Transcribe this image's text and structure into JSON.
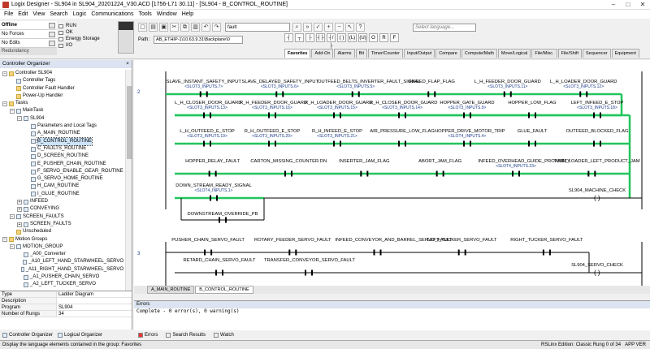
{
  "window": {
    "title": "Logix Designer - SL904 in SL904_20201224_V30.ACD [1756-L71 30.11] - [SL904 - B_CONTROL_ROUTINE]",
    "minimize": "–",
    "maximize": "□",
    "close": "✕"
  },
  "menu": [
    "File",
    "Edit",
    "View",
    "Search",
    "Logic",
    "Communications",
    "Tools",
    "Window",
    "Help"
  ],
  "controller_status": {
    "mode": "Offline",
    "forces": "No Forces",
    "edits": "No Edits",
    "redundancy": "Redundancy",
    "leds": [
      "RUN",
      "OK",
      "Energy Storage",
      "I/O"
    ]
  },
  "toolbar": {
    "search_value": "fault",
    "language_search_placeholder": "Select language...",
    "path_label": "Path:",
    "path_value": "AB_ETHIP-1\\10.63.9.31\\Backplane\\0"
  },
  "instruction_tabs": [
    "Favorites",
    "Add-On",
    "Alarms",
    "Bit",
    "Timer/Counter",
    "Input/Output",
    "Compare",
    "Compute/Math",
    "Move/Logical",
    "File/Misc.",
    "File/Shift",
    "Sequencer",
    "Equipment"
  ],
  "organizer": {
    "title": "Controller Organizer",
    "close": "×",
    "tree": [
      {
        "label": "Controller SL904",
        "level": 0,
        "exp": "−",
        "type": "folder"
      },
      {
        "label": "Controller Tags",
        "level": 1,
        "exp": "",
        "type": "item"
      },
      {
        "label": "Controller Fault Handler",
        "level": 1,
        "exp": "",
        "type": "folder"
      },
      {
        "label": "Power-Up Handler",
        "level": 1,
        "exp": "",
        "type": "folder"
      },
      {
        "label": "Tasks",
        "level": 0,
        "exp": "−",
        "type": "folder"
      },
      {
        "label": "MainTask",
        "level": 1,
        "exp": "−",
        "type": "item"
      },
      {
        "label": "SL904",
        "level": 2,
        "exp": "−",
        "type": "item"
      },
      {
        "label": "Parameters and Local Tags",
        "level": 3,
        "exp": "",
        "type": "item"
      },
      {
        "label": "A_MAIN_ROUTINE",
        "level": 3,
        "exp": "",
        "type": "item"
      },
      {
        "label": "B_CONTROL_ROUTINE",
        "level": 3,
        "exp": "",
        "type": "item",
        "selected": true
      },
      {
        "label": "C_FAULTS_ROUTINE",
        "level": 3,
        "exp": "",
        "type": "item"
      },
      {
        "label": "D_SCREEN_ROUTINE",
        "level": 3,
        "exp": "",
        "type": "item"
      },
      {
        "label": "E_PUSHER_CHAIN_ROUTINE",
        "level": 3,
        "exp": "",
        "type": "item"
      },
      {
        "label": "F_SERVO_ENABLE_GEAR_ROUTINE",
        "level": 3,
        "exp": "",
        "type": "item"
      },
      {
        "label": "G_SERVO_HOME_ROUTINE",
        "level": 3,
        "exp": "",
        "type": "item"
      },
      {
        "label": "H_CAM_ROUTINE",
        "level": 3,
        "exp": "",
        "type": "item"
      },
      {
        "label": "I_GLUE_ROUTINE",
        "level": 3,
        "exp": "",
        "type": "item"
      },
      {
        "label": "INFEED",
        "level": 2,
        "exp": "+",
        "type": "item"
      },
      {
        "label": "CONVEYING",
        "level": 2,
        "exp": "+",
        "type": "item"
      },
      {
        "label": "SCREEN_FAULTS",
        "level": 1,
        "exp": "−",
        "type": "item"
      },
      {
        "label": "SCREEN_FAULTS",
        "level": 2,
        "exp": "+",
        "type": "item"
      },
      {
        "label": "Unscheduled",
        "level": 1,
        "exp": "",
        "type": "folder"
      },
      {
        "label": "Motion Groups",
        "level": 0,
        "exp": "−",
        "type": "folder"
      },
      {
        "label": "MOTION_GROUP",
        "level": 1,
        "exp": "−",
        "type": "item"
      },
      {
        "label": "_A00_Converter",
        "level": 2,
        "exp": "",
        "type": "item"
      },
      {
        "label": "_A10_LEFT_HAND_STARWHEEL_SERVO",
        "level": 2,
        "exp": "",
        "type": "item"
      },
      {
        "label": "_A11_RIGHT_HAND_STARWHEEL_SERVO",
        "level": 2,
        "exp": "",
        "type": "item"
      },
      {
        "label": "_A1_PUSHER_CHAIN_SERVO",
        "level": 2,
        "exp": "",
        "type": "item"
      },
      {
        "label": "_A2_LEFT_TUCKER_SERVO",
        "level": 2,
        "exp": "",
        "type": "item"
      }
    ]
  },
  "properties": [
    {
      "k": "Type",
      "v": "Ladder Diagram"
    },
    {
      "k": "Description",
      "v": ""
    },
    {
      "k": "Program",
      "v": "SL904"
    },
    {
      "k": "Number of Rungs",
      "v": "34"
    }
  ],
  "organizer_tabs": [
    "Controller Organizer",
    "Logical Organizer"
  ],
  "rungs": {
    "rung2": "2",
    "rung3": "3",
    "r2_l1": [
      {
        "name": "SLAVE_INSTANT_SAFETY_INPUT",
        "addr": "<SLOT3_INPUTS.7>"
      },
      {
        "name": "SLAVE_DELAYED_SAFETY_INPUT",
        "addr": "<SLOT3_INPUTS.6>"
      },
      {
        "name": "OUTFEED_BELTS_INVERTER_FAULT_SIGNAL",
        "addr": "<SLOT3_INPUTS.5>"
      },
      {
        "name": "INFEED_FLAP_FLAG",
        "addr": ""
      },
      {
        "name": "L_H_FEEDER_DOOR_GUARD",
        "addr": "<SLOT3_INPUTS.11>"
      },
      {
        "name": "L_H_LOADER_DOOR_GUARD",
        "addr": "<SLOT3_INPUTS.12>"
      }
    ],
    "r2_l2": [
      {
        "name": "L_H_CLOSER_DOOR_GUARD",
        "addr": "<SLOT3_INPUTS.13>"
      },
      {
        "name": "R_H_FEEDER_DOOR_GUARD",
        "addr": "<SLOT3_INPUTS.16>"
      },
      {
        "name": "R_H_LOADER_DOOR_GUARD",
        "addr": "<SLOT3_INPUTS.15>"
      },
      {
        "name": "R_H_CLOSER_DOOR_GUARD",
        "addr": "<SLOT3_INPUTS.14>"
      },
      {
        "name": "HOPPER_GATE_GUARD",
        "addr": "<SLOT3_INPUTS.9>"
      },
      {
        "name": "HOPPER_LOW_FLAG",
        "addr": ""
      },
      {
        "name": "LEFT_INFEED_E_STOP",
        "addr": "<SLOT3_INPUTS.18>"
      }
    ],
    "r2_l3": [
      {
        "name": "L_H_OUTFEED_E_STOP",
        "addr": "<SLOT3_INPUTS.19>"
      },
      {
        "name": "R_H_OUTFEED_E_STOP",
        "addr": "<SLOT3_INPUTS.20>"
      },
      {
        "name": "R_H_INFEED_E_STOP",
        "addr": "<SLOT3_INPUTS.21>"
      },
      {
        "name": "AIR_PRESSURE_LOW_FLAG",
        "addr": ""
      },
      {
        "name": "HOPPER_DRIVE_MOTOR_TRIP",
        "addr": "<SLOT4_INPUTS.4>"
      },
      {
        "name": "GLUE_FAULT",
        "addr": ""
      },
      {
        "name": "OUTFEED_BLOCKED_FLAG",
        "addr": ""
      }
    ],
    "r2_l4": [
      {
        "name": "HOPPER_RELAY_FAULT",
        "addr": ""
      },
      {
        "name": "CARTON_MISSING_COUNTER.DN",
        "addr": ""
      },
      {
        "name": "INSERTER_JAM_FLAG",
        "addr": ""
      },
      {
        "name": "ABORT_JAM_FLAG",
        "addr": ""
      },
      {
        "name": "INFEED_OVERHEAD_GUIDE_PROXIMITY",
        "addr": "<SLOT4_INPUTS.23>"
      },
      {
        "name": "TWIN_LOADER_LEFT_PRODUCT_JAM",
        "addr": ""
      }
    ],
    "r2_l5": [
      {
        "name": "DOWN_STREAM_READY_SIGNAL",
        "addr": "<SLOT4_INPUTS.1>"
      }
    ],
    "r2_branch": {
      "name": "DOWNSTREAM_OVERRIDE_PB",
      "addr": ""
    },
    "r2_coil": "SL904_MACHINE_CHECK",
    "r3_l1": [
      {
        "name": "PUSHER_CHAIN_SERVO_FAULT",
        "addr": ""
      },
      {
        "name": "ROTARY_FEEDER_SERVO_FAULT",
        "addr": ""
      },
      {
        "name": "INFEED_CONVEYOR_AND_BARREL_SERVO_FAULT",
        "addr": ""
      },
      {
        "name": "LEFT_TUCKER_SERVO_FAULT",
        "addr": ""
      },
      {
        "name": "RIGHT_TUCKER_SERVO_FAULT",
        "addr": ""
      }
    ],
    "r3_l2": [
      {
        "name": "RETARD_CHAIN_SERVO_FAULT",
        "addr": ""
      },
      {
        "name": "TRANSFER_CONVEYOR_SERVO_FAULT",
        "addr": ""
      }
    ],
    "r3_coil": "SL904_SERVO_CHECK"
  },
  "editor_tabs": [
    "A_MAIN_ROUTINE",
    "B_CONTROL_ROUTINE"
  ],
  "errors": {
    "title": "Errors",
    "line": "Complete - 0 error(s), 0 warning(s)"
  },
  "bottom_tabs": [
    "Errors",
    "Search Results",
    "Watch"
  ],
  "status": {
    "left": "Display the language elements contained in the group: Favorites",
    "right": "RSLinx Edition: Classic    Rung 0 of 34",
    "mode": "APP   VER"
  }
}
